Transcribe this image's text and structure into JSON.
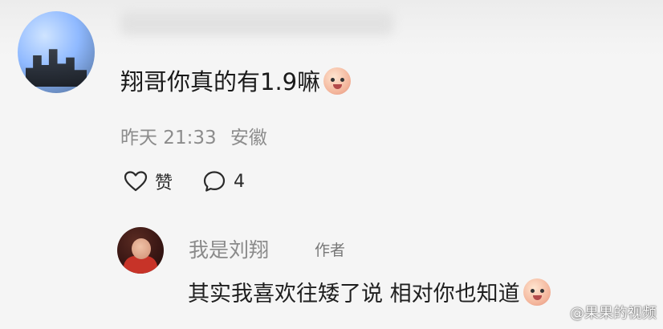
{
  "comment": {
    "text": "翔哥你真的有1.9嘛",
    "emoji_icon": "smiling-face-emoji-icon",
    "time": "昨天 21:33",
    "location": "安徽",
    "like_label": "赞",
    "reply_count": "4"
  },
  "reply": {
    "username": "我是刘翔",
    "badge": "作者",
    "text": "其实我喜欢往矮了说 相对你也知道",
    "emoji_icon": "smiling-face-emoji-icon"
  },
  "watermark": {
    "text": "@果果的视频"
  },
  "icons": {
    "like": "heart-outline-icon",
    "comment": "speech-bubble-icon"
  },
  "colors": {
    "background": "#f5f5f5",
    "primary_text": "#1a1a1a",
    "meta_text": "#8c8c8c"
  }
}
